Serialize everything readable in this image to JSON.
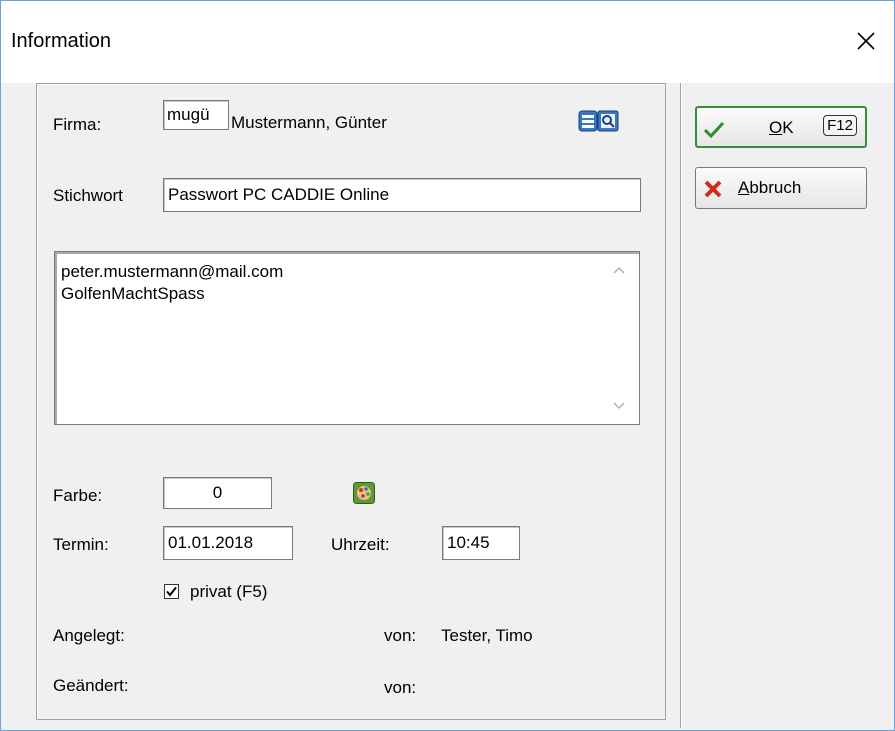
{
  "window": {
    "title": "Information"
  },
  "form": {
    "firma_label": "Firma:",
    "firma_code": "mugü",
    "firma_name": "Mustermann, Günter",
    "stichwort_label": "Stichwort",
    "stichwort_value": "Passwort PC CADDIE Online",
    "memo_lines": [
      "peter.mustermann@mail.com",
      "GolfenMachtSpass"
    ],
    "farbe_label": "Farbe:",
    "farbe_value": "0",
    "termin_label": "Termin:",
    "termin_value": "01.01.2018",
    "uhrzeit_label": "Uhrzeit:",
    "uhrzeit_value": "10:45",
    "privat_label": "privat (F5)",
    "privat_checked": true,
    "angelegt_label": "Angelegt:",
    "angelegt_von_label": "von:",
    "angelegt_von_value": "Tester, Timo",
    "geaendert_label": "Geändert:",
    "geaendert_von_label": "von:"
  },
  "buttons": {
    "ok_prefix": "",
    "ok_mnemonic": "O",
    "ok_rest": "K",
    "ok_key": "F12",
    "cancel_mnemonic": "A",
    "cancel_rest": "bbruch"
  },
  "icons": {
    "close": "close-icon",
    "lookup": "record-search-icon",
    "color": "color-palette-icon",
    "ok": "check-icon",
    "cancel": "x-icon"
  },
  "colors": {
    "window_border": "#6fa1d8",
    "default_button_border": "#3a8c3a",
    "ok_check": "#2e8b2e",
    "cancel_x": "#d42a1e"
  }
}
